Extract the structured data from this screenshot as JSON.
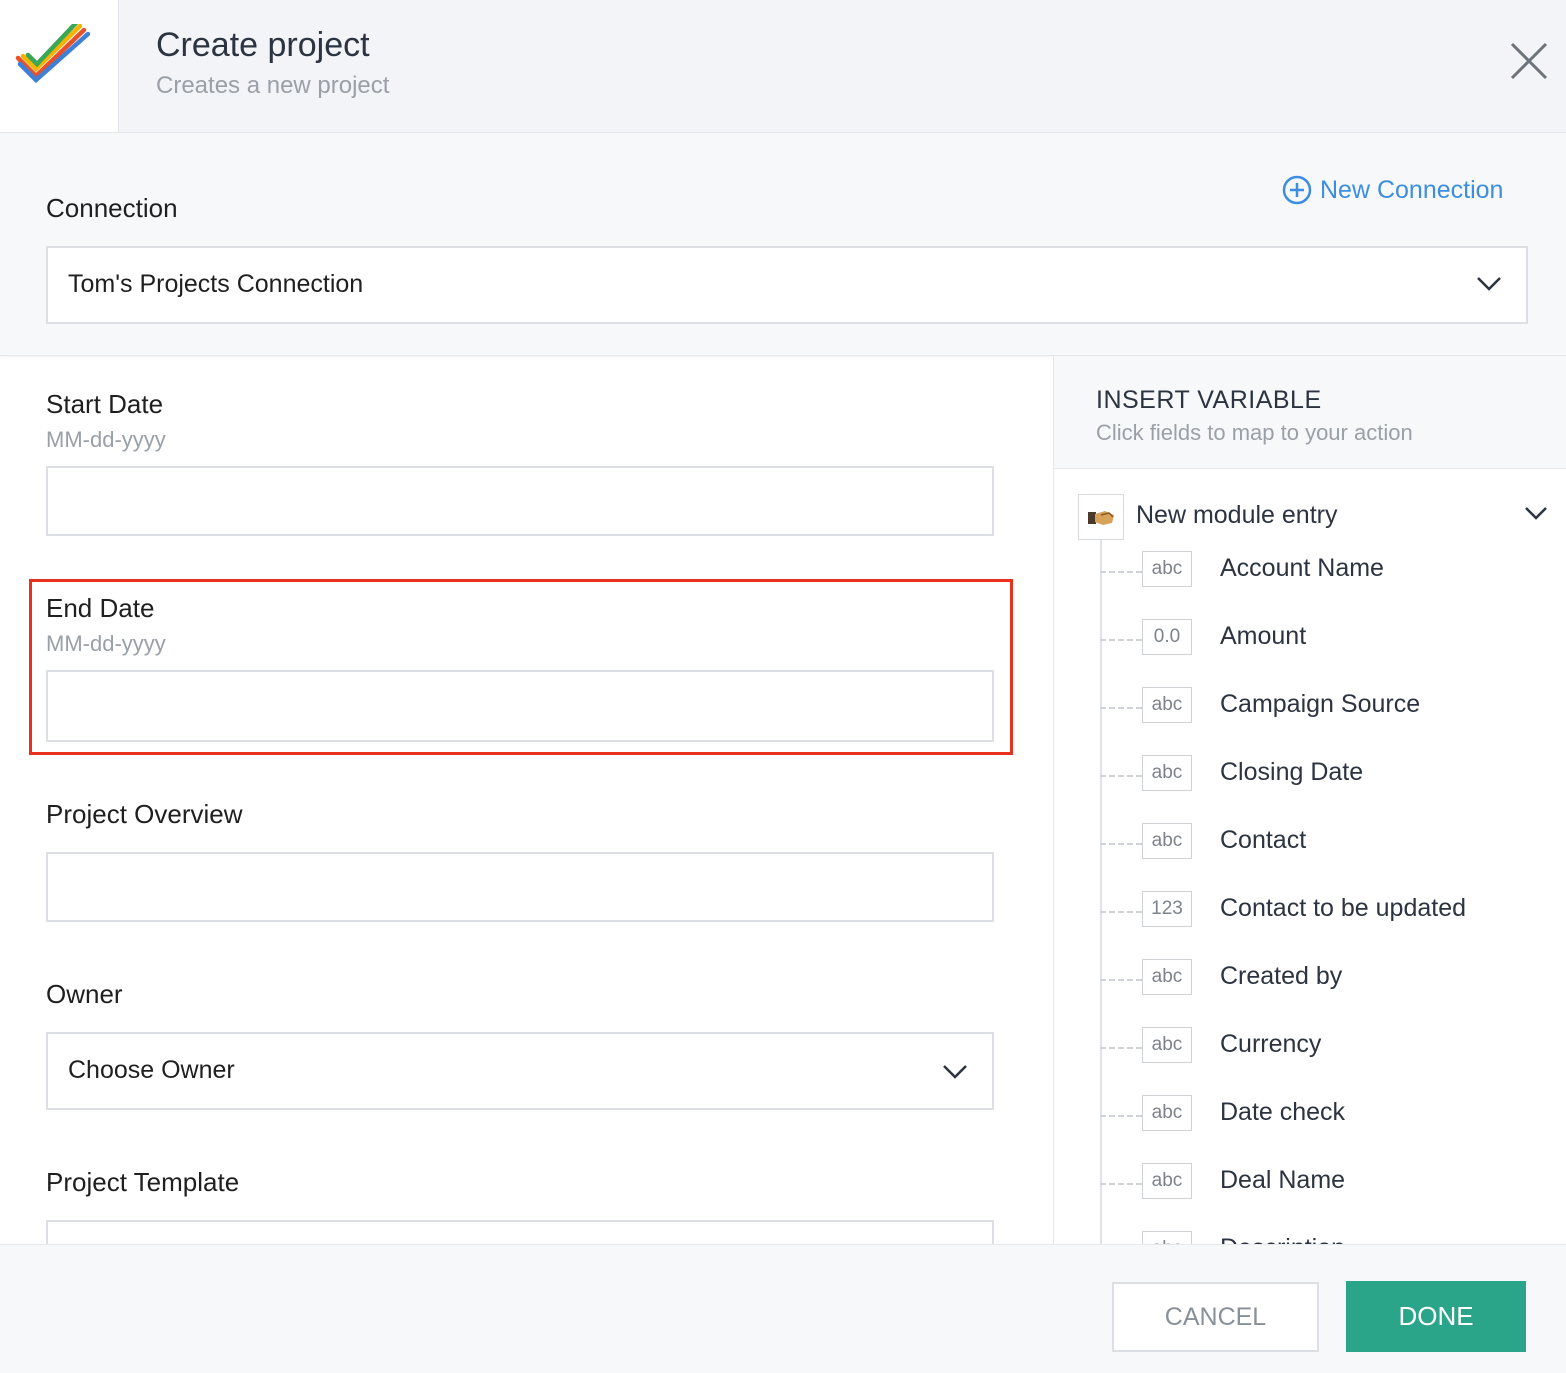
{
  "header": {
    "title": "Create project",
    "subtitle": "Creates a new project",
    "logo": "checkmark-logo",
    "close_icon": "close-icon"
  },
  "connection": {
    "label": "Connection",
    "new_connection_label": "New Connection",
    "selected": "Tom's Projects Connection"
  },
  "form": {
    "start_date": {
      "label": "Start Date",
      "hint": "MM-dd-yyyy",
      "value": ""
    },
    "end_date": {
      "label": "End Date",
      "hint": "MM-dd-yyyy",
      "value": ""
    },
    "project_overview": {
      "label": "Project Overview",
      "value": ""
    },
    "owner": {
      "label": "Owner",
      "selected": "Choose Owner"
    },
    "project_template": {
      "label": "Project Template"
    }
  },
  "insert_variable": {
    "title": "INSERT VARIABLE",
    "subtitle": "Click fields to map to your action",
    "module": "New module entry",
    "items": [
      {
        "type": "abc",
        "name": "Account Name"
      },
      {
        "type": "0.0",
        "name": "Amount"
      },
      {
        "type": "abc",
        "name": "Campaign Source"
      },
      {
        "type": "abc",
        "name": "Closing Date"
      },
      {
        "type": "abc",
        "name": "Contact"
      },
      {
        "type": "123",
        "name": "Contact to be updated"
      },
      {
        "type": "abc",
        "name": "Created by"
      },
      {
        "type": "abc",
        "name": "Currency"
      },
      {
        "type": "abc",
        "name": "Date check"
      },
      {
        "type": "abc",
        "name": "Deal Name"
      },
      {
        "type": "abc",
        "name": "Description"
      }
    ]
  },
  "footer": {
    "cancel": "CANCEL",
    "done": "DONE"
  },
  "colors": {
    "accent": "#3d8ee0",
    "done": "#2ba58a",
    "highlight": "#e8321f"
  }
}
